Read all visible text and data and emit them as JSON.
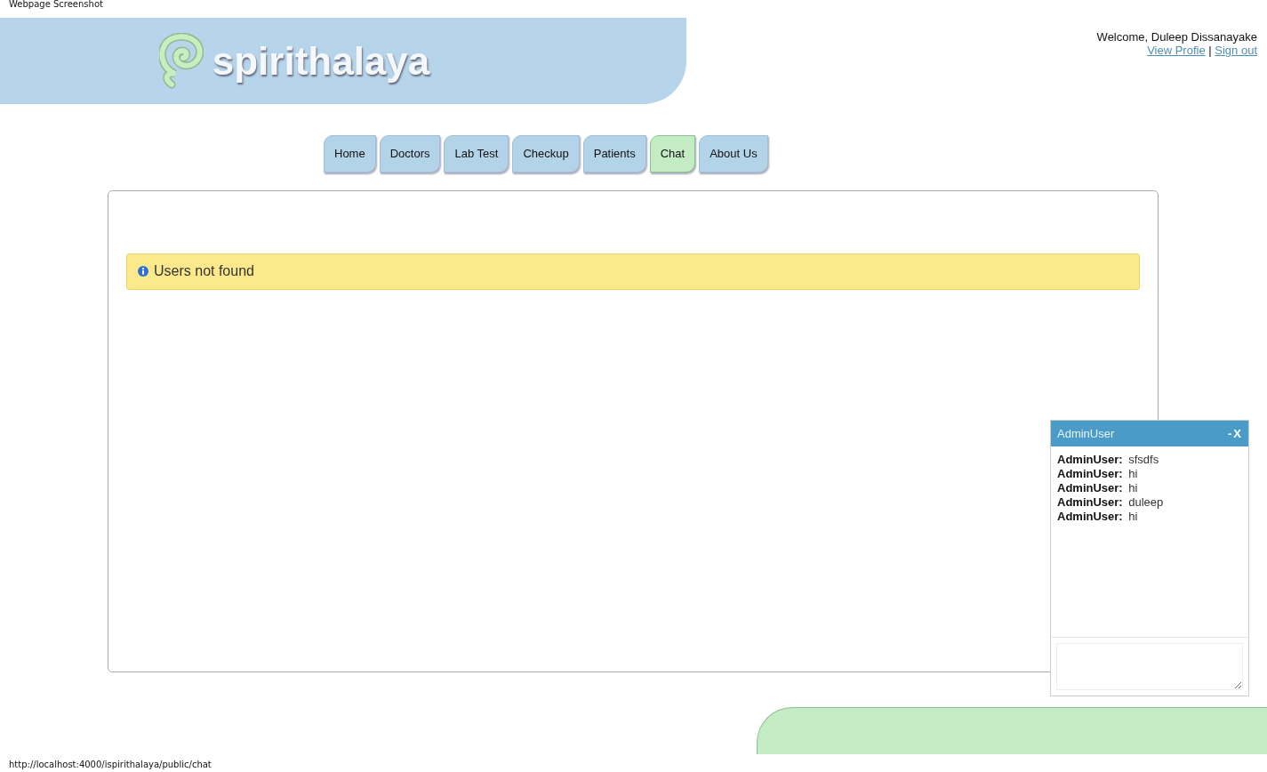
{
  "page_caption": "Webpage Screenshot",
  "header": {
    "brand": "spirithalaya",
    "welcome": "Welcome, Duleep Dissanayake",
    "links": [
      {
        "label": "View Profie"
      },
      {
        "label": "Sign out"
      }
    ],
    "separator": "|"
  },
  "nav": [
    {
      "label": "Home",
      "selected": false
    },
    {
      "label": "Doctors",
      "selected": false
    },
    {
      "label": "Lab Test",
      "selected": false
    },
    {
      "label": "Checkup",
      "selected": false
    },
    {
      "label": "Patients",
      "selected": false
    },
    {
      "label": "Chat",
      "selected": true
    },
    {
      "label": "About Us",
      "selected": false
    }
  ],
  "alert": {
    "message": "Users not found"
  },
  "chat": {
    "title": "AdminUser",
    "controls": [
      "-",
      "X"
    ],
    "messages": [
      {
        "sender": "AdminUser:",
        "text": "sfsdfs"
      },
      {
        "sender": "AdminUser:",
        "text": "hi"
      },
      {
        "sender": "AdminUser:",
        "text": "hi"
      },
      {
        "sender": "AdminUser:",
        "text": "duleep"
      },
      {
        "sender": "AdminUser:",
        "text": "hi"
      }
    ]
  },
  "status_url": "http://localhost:4000/ispirithalaya/public/chat"
}
